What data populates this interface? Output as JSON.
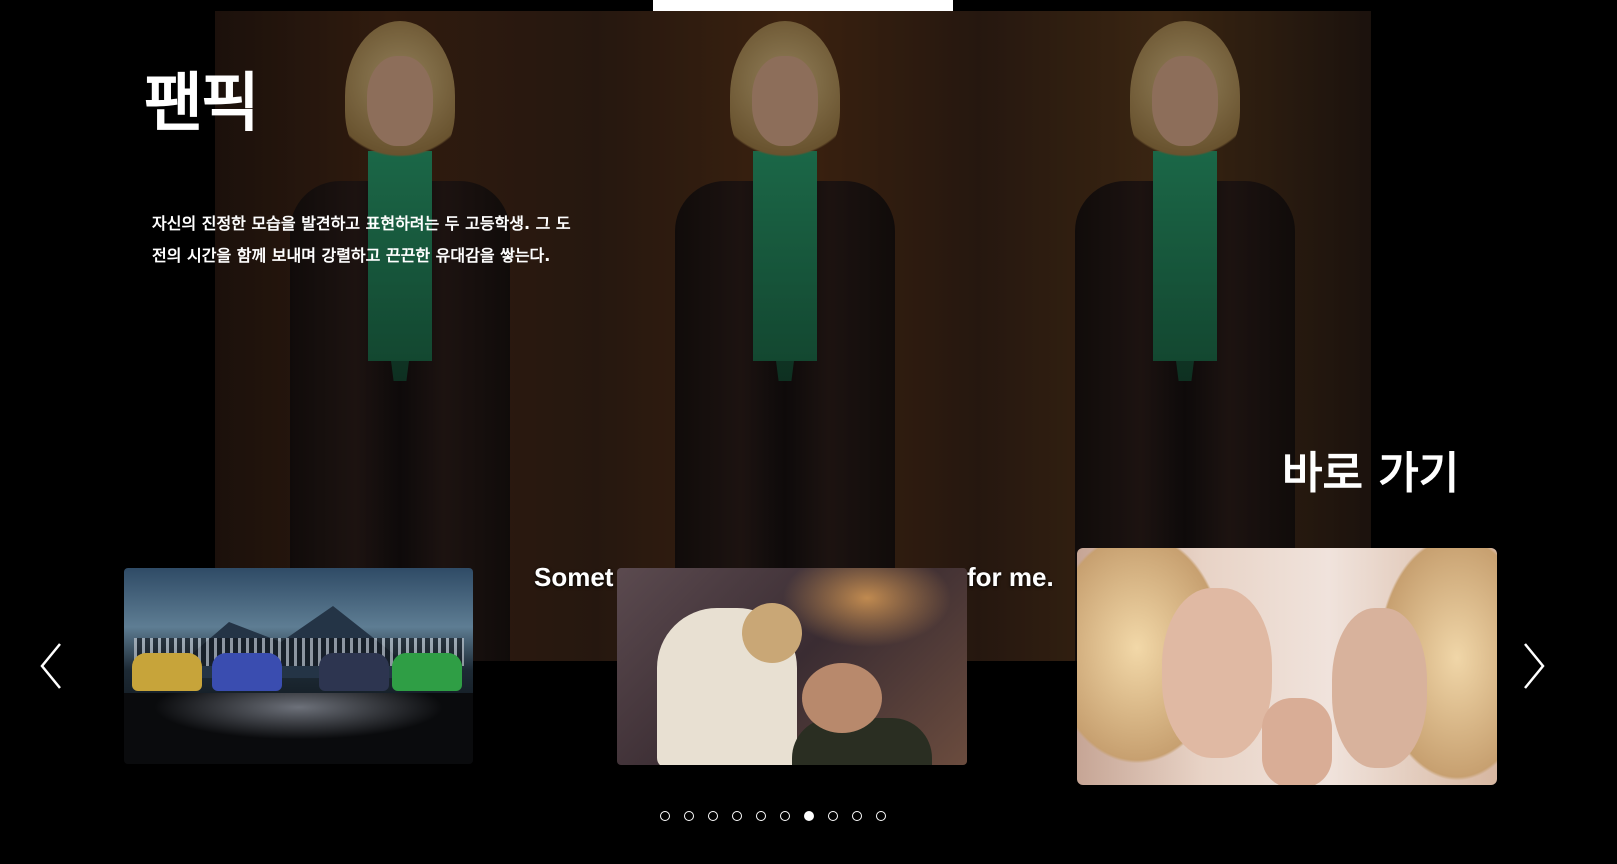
{
  "hero": {
    "title": "팬픽",
    "description": "자신의 진정한 모습을 발견하고 표현하려는 두 고등학생. 그 도전의 시간을 함께 보내며 강렬하고 끈끈한 유대감을 쌓는다.",
    "subtitle_left": "Somet",
    "subtitle_right": "for me.",
    "cta": "바로 가기"
  },
  "carousel": {
    "prev_icon": "chevron-left-icon",
    "next_icon": "chevron-right-icon",
    "cards": [
      {
        "id": "card-1",
        "scene": "night car meet poster"
      },
      {
        "id": "card-2",
        "scene": "two people lying on bed"
      },
      {
        "id": "card-3",
        "scene": "blonde women close-up"
      }
    ],
    "page_count": 10,
    "active_index": 6
  },
  "colors": {
    "background": "#000000",
    "text": "#ffffff"
  }
}
